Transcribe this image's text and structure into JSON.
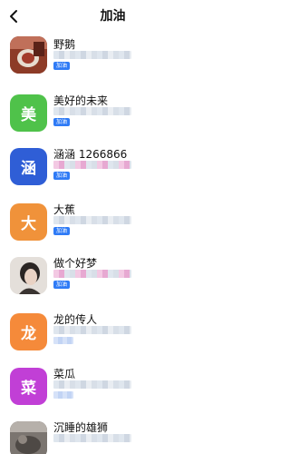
{
  "header": {
    "title": "加油"
  },
  "items": [
    {
      "name": "野鹅",
      "badge": "加油",
      "avatar": {
        "type": "photo",
        "char": "",
        "color": "#8a3a2a"
      }
    },
    {
      "name": "美好的未来",
      "badge": "加油",
      "avatar": {
        "type": "letter",
        "char": "美",
        "color": "#4fc24a"
      }
    },
    {
      "name": "涵涵 1266866",
      "badge": "加油",
      "avatar": {
        "type": "letter",
        "char": "涵",
        "color": "#2f5ed6"
      }
    },
    {
      "name": "大蕉",
      "badge": "加油",
      "avatar": {
        "type": "letter",
        "char": "大",
        "color": "#f0923a"
      }
    },
    {
      "name": "做个好梦",
      "badge": "加油",
      "avatar": {
        "type": "photo",
        "char": "",
        "color": "#d9d4d0"
      }
    },
    {
      "name": "龙的传人",
      "badge": "",
      "avatar": {
        "type": "letter",
        "char": "龙",
        "color": "#f58a3a"
      }
    },
    {
      "name": "菜瓜",
      "badge": "",
      "avatar": {
        "type": "letter",
        "char": "菜",
        "color": "#c13fd6"
      }
    },
    {
      "name": "沉睡的雄狮",
      "badge": "",
      "avatar": {
        "type": "photo",
        "char": "",
        "color": "#6f6a66"
      }
    }
  ]
}
